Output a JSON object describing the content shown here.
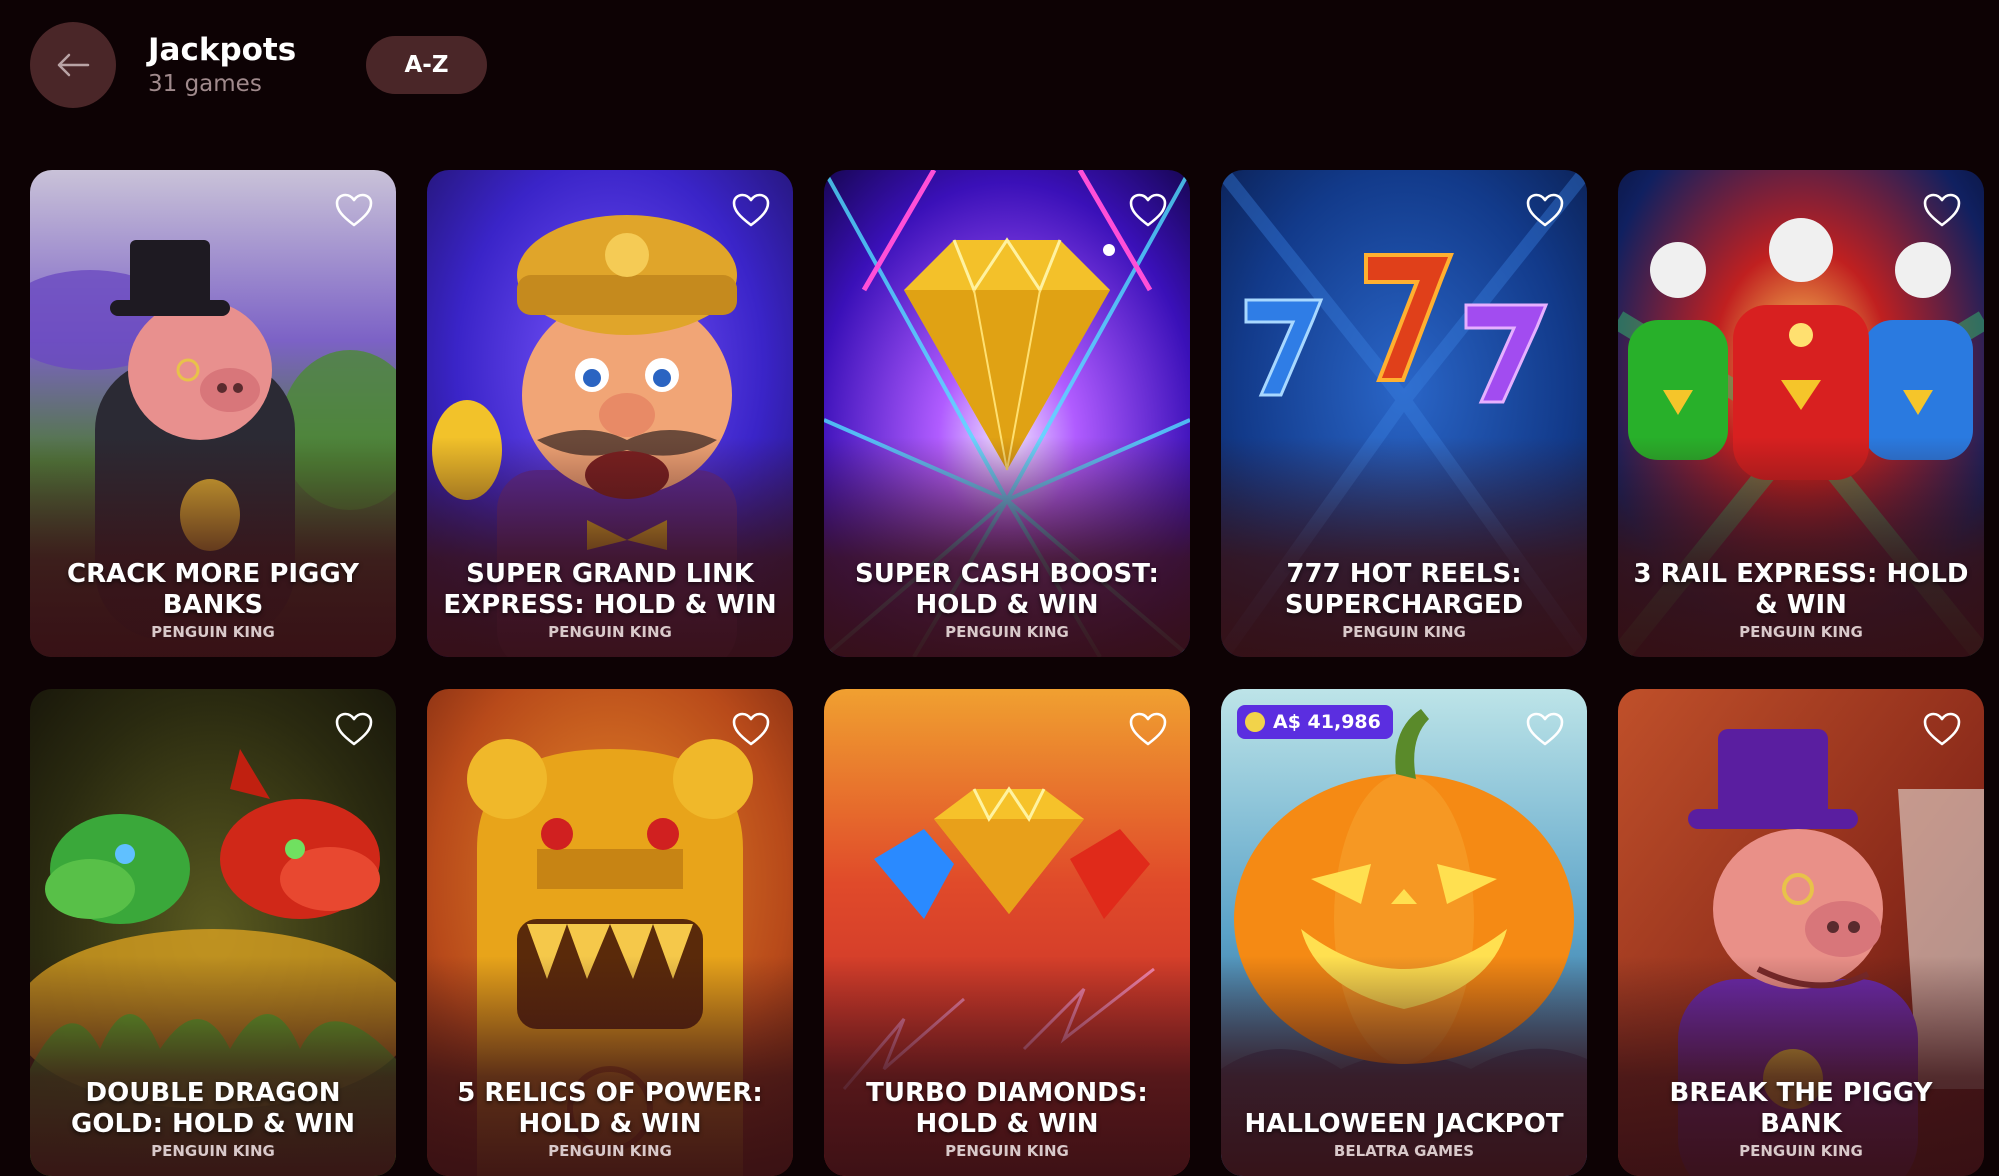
{
  "header": {
    "title": "Jackpots",
    "count": "31 games",
    "sort_label": "A-Z"
  },
  "games": [
    {
      "title": "CRACK MORE PIGGY BANKS",
      "provider": "PENGUIN KING",
      "art": "piggy-top-hat-garden"
    },
    {
      "title": "SUPER GRAND LINK EXPRESS: HOLD & WIN",
      "provider": "PENGUIN KING",
      "art": "mustached-conductor"
    },
    {
      "title": "SUPER CASH BOOST: HOLD & WIN",
      "provider": "PENGUIN KING",
      "art": "golden-diamond"
    },
    {
      "title": "777 HOT REELS: SUPERCHARGED",
      "provider": "PENGUIN KING",
      "art": "triple-sevens"
    },
    {
      "title": "3 RAIL EXPRESS: HOLD & WIN",
      "provider": "PENGUIN KING",
      "art": "three-trains"
    },
    {
      "title": "DOUBLE DRAGON GOLD: HOLD & WIN",
      "provider": "PENGUIN KING",
      "art": "green-red-dragons"
    },
    {
      "title": "5 RELICS OF POWER: HOLD & WIN",
      "provider": "PENGUIN KING",
      "art": "golden-idol"
    },
    {
      "title": "TURBO DIAMONDS: HOLD & WIN",
      "provider": "PENGUIN KING",
      "art": "three-gems"
    },
    {
      "title": "HALLOWEEN JACKPOT",
      "provider": "BELATRA GAMES",
      "art": "jack-o-lantern",
      "jackpot": "A$ 41,986"
    },
    {
      "title": "BREAK THE PIGGY BANK",
      "provider": "PENGUIN KING",
      "art": "piggy-purple-hat"
    }
  ],
  "colors": {
    "background": "#0d0204",
    "button": "#4a2628",
    "jackpot_badge": "#5b2ee0"
  }
}
